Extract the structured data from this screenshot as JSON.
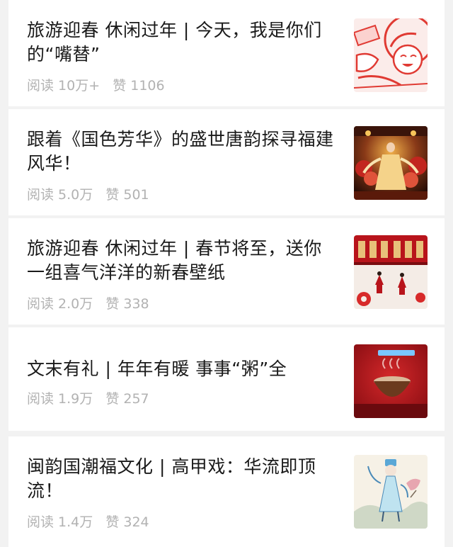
{
  "articles": [
    {
      "title": "旅游迎春 休闲过年 | 今天，我是你们的“嘴替”",
      "reads": "阅读 10万+",
      "likes": "赞 1106",
      "thumbnail": "cartoon-red-illustration"
    },
    {
      "title": "跟着《国色芳华》的盛世唐韵探寻福建风华！",
      "reads": "阅读 5.0万",
      "likes": "赞 501",
      "thumbnail": "tang-dynasty-dancer-scene"
    },
    {
      "title": "旅游迎春 休闲过年 | 春节将至，送你一组喜气洋洋的新春壁纸",
      "reads": "阅读 2.0万",
      "likes": "赞 338",
      "thumbnail": "red-palace-new-year-wallpaper"
    },
    {
      "title": "文末有礼 | 年年有暖 事事“粥”全",
      "reads": "阅读 1.9万",
      "likes": "赞 257",
      "thumbnail": "steaming-porridge-bowl-red"
    },
    {
      "title": "闽韵国潮福文化 | 高甲戏：华流即顶流！",
      "reads": "阅读 1.4万",
      "likes": "赞 324",
      "thumbnail": "opera-performer-ink-painting"
    }
  ],
  "colors": {
    "background": "#f2f2f2",
    "card": "#ffffff",
    "title": "#1a1a1a",
    "meta": "#b2b2b2"
  }
}
